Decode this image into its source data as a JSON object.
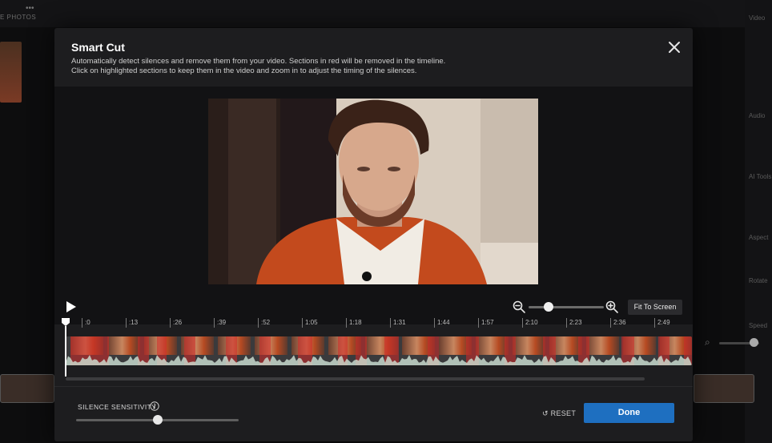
{
  "background": {
    "left_label": "E PHOTOS",
    "right_labels": [
      "Video",
      "Audio",
      "AI Tools",
      "Aspect",
      "Rotate",
      "Speed"
    ]
  },
  "modal": {
    "title": "Smart Cut",
    "description_line1": "Automatically detect silences and remove them from your video. Sections in red will be removed in the timeline.",
    "description_line2": "Click on highlighted sections to keep them in the video and zoom in to adjust the timing of the silences.",
    "close_icon": "close-icon"
  },
  "controls": {
    "play_icon": "play-icon",
    "zoom_out_icon": "zoom-out-icon",
    "zoom_in_icon": "zoom-in-icon",
    "zoom_level": 0.27,
    "fit_to_screen_label": "Fit To Screen"
  },
  "timeline": {
    "ticks": [
      ":0",
      ":13",
      ":26",
      ":39",
      ":52",
      "1:05",
      "1:18",
      "1:31",
      "1:44",
      "1:57",
      "2:10",
      "2:23",
      "2:36",
      "2:49"
    ],
    "playhead_seconds": 0
  },
  "footer": {
    "sensitivity_label": "SILENCE SENSITIVITY",
    "sensitivity_value": 0.5,
    "info_icon": "info-icon",
    "reset_label": "RESET",
    "reset_icon": "reset-icon",
    "done_label": "Done"
  },
  "colors": {
    "accent": "#1e6fc0",
    "removed_section": "#d22828",
    "modal_bg": "#1d1d1f"
  }
}
